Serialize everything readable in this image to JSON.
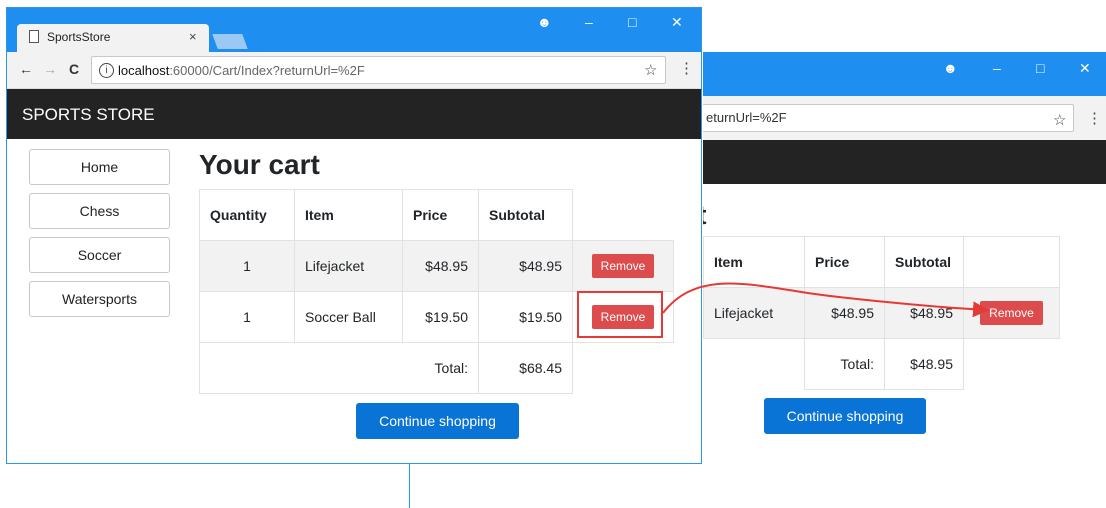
{
  "back_window": {
    "url": "eturnUrl=%2F",
    "heading": "rt",
    "table": {
      "headers": [
        "Item",
        "Price",
        "Subtotal",
        ""
      ],
      "rows": [
        {
          "item": "Lifejacket",
          "price": "$48.95",
          "subtotal": "$48.95",
          "remove": "Remove"
        }
      ],
      "total_label": "Total:",
      "total_value": "$48.95"
    },
    "continue_label": "Continue shopping"
  },
  "front_window": {
    "tab_title": "SportsStore",
    "url_host": "localhost",
    "url_path": ":60000/Cart/Index?returnUrl=%2F",
    "brand": "SPORTS STORE",
    "sidebar": [
      {
        "label": "Home"
      },
      {
        "label": "Chess"
      },
      {
        "label": "Soccer"
      },
      {
        "label": "Watersports"
      }
    ],
    "heading": "Your cart",
    "table": {
      "headers": [
        "Quantity",
        "Item",
        "Price",
        "Subtotal",
        ""
      ],
      "rows": [
        {
          "quantity": "1",
          "item": "Lifejacket",
          "price": "$48.95",
          "subtotal": "$48.95",
          "remove": "Remove"
        },
        {
          "quantity": "1",
          "item": "Soccer Ball",
          "price": "$19.50",
          "subtotal": "$19.50",
          "remove": "Remove"
        }
      ],
      "total_label": "Total:",
      "total_value": "$68.45"
    },
    "continue_label": "Continue shopping"
  },
  "glyphs": {
    "account": "☻",
    "minimize": "–",
    "maximize": "□",
    "close": "✕",
    "back": "←",
    "forward": "→",
    "reload": "C",
    "star": "☆",
    "menu": "⋮",
    "info": "i",
    "tab_close": "×"
  },
  "colors": {
    "titlebar": "#1e8ff0",
    "navbar": "#232323",
    "primary": "#0a74d6",
    "danger": "#dc4c4c",
    "highlight": "#e53935"
  }
}
